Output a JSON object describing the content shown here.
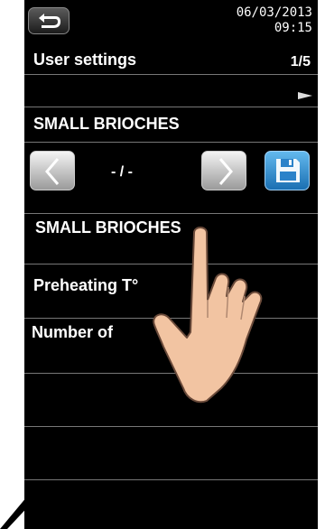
{
  "header": {
    "date": "06/03/2013",
    "time": "09:15"
  },
  "screen": {
    "title": "User settings",
    "page": "1/5"
  },
  "program": {
    "name": "SMALL BRIOCHES",
    "selector_value": "- / -",
    "field_value": "SMALL BRIOCHES"
  },
  "rows": [
    {
      "label": "Preheating T°"
    },
    {
      "label": "Number of"
    }
  ],
  "icons": {
    "back": "return-arrow-icon",
    "prev": "chevron-left-icon",
    "next": "chevron-right-icon",
    "save": "floppy-disk-icon",
    "more": "small-right-arrow-icon"
  },
  "colors": {
    "background": "#000000",
    "text": "#ffffff",
    "save_button": "#3d9be0",
    "divider": "#777777"
  }
}
